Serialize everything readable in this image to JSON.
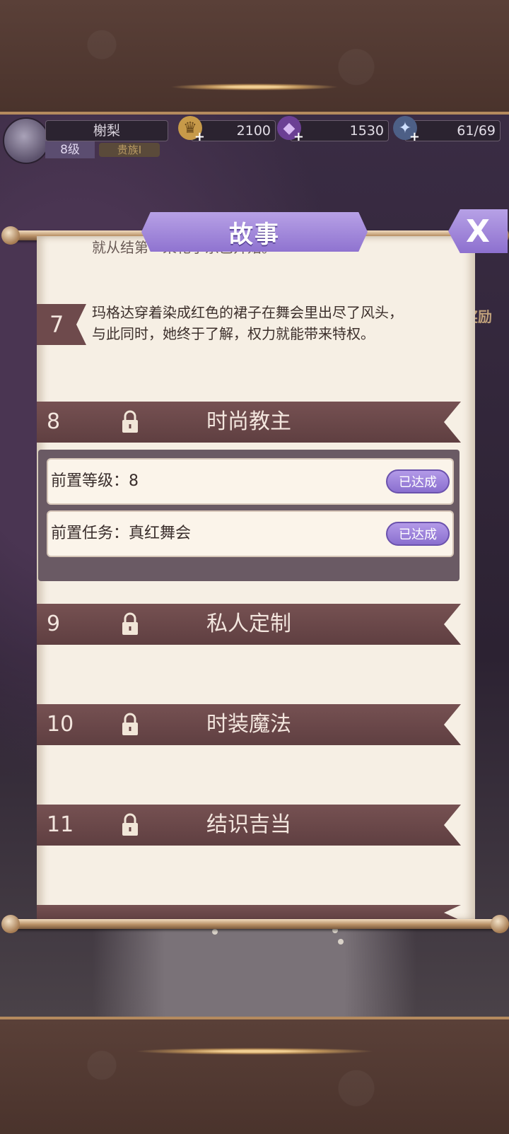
{
  "hud": {
    "player_name": "榭梨",
    "level": "8级",
    "rank": "贵族I",
    "gold": "2100",
    "gems": "1530",
    "stamina": "61/69"
  },
  "dialog": {
    "title": "故事",
    "close_label": "X"
  },
  "story": {
    "partial_top_text": "就从结第一束花子宗巴开始。",
    "chapter7": {
      "number": "7",
      "line1": "玛格达穿着染成红色的裙子在舞会里出尽了风头，",
      "line2": "与此同时，她终于了解，权力就能带来特权。"
    },
    "chapters": [
      {
        "number": "8",
        "title": "时尚教主"
      },
      {
        "number": "9",
        "title": "私人定制"
      },
      {
        "number": "10",
        "title": "时装魔法"
      },
      {
        "number": "11",
        "title": "结识吉当"
      }
    ],
    "requirements": [
      {
        "label": "前置等级：8",
        "status": "已达成"
      },
      {
        "label": "前置任务：真红舞会",
        "status": "已达成"
      }
    ]
  },
  "side": {
    "reward_text": "奖励"
  },
  "colors": {
    "accent": "#9a80d8",
    "banner": "#6a4648",
    "paper": "#f6efe4"
  }
}
